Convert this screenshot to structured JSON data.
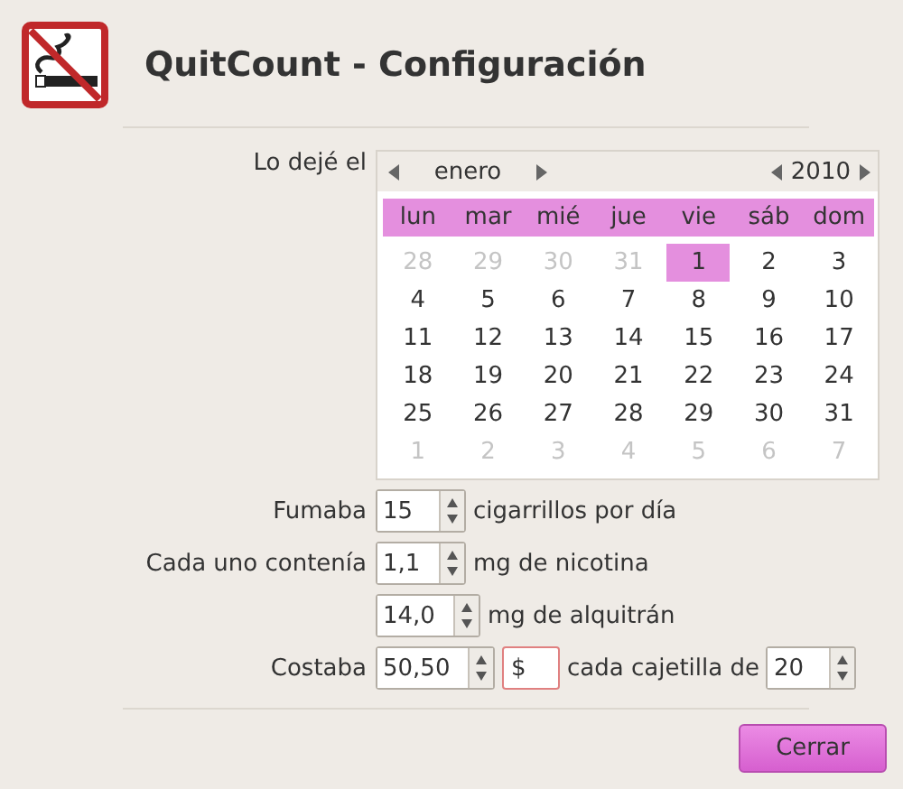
{
  "header": {
    "title": "QuitCount - Configuración"
  },
  "quit_date": {
    "label": "Lo dejé el",
    "calendar": {
      "month": "enero",
      "year": "2010",
      "weekdays": [
        "lun",
        "mar",
        "mié",
        "jue",
        "vie",
        "sáb",
        "dom"
      ],
      "days": [
        {
          "day": "28",
          "other_month": true,
          "selected": false
        },
        {
          "day": "29",
          "other_month": true,
          "selected": false
        },
        {
          "day": "30",
          "other_month": true,
          "selected": false
        },
        {
          "day": "31",
          "other_month": true,
          "selected": false
        },
        {
          "day": "1",
          "other_month": false,
          "selected": true
        },
        {
          "day": "2",
          "other_month": false,
          "selected": false
        },
        {
          "day": "3",
          "other_month": false,
          "selected": false
        },
        {
          "day": "4",
          "other_month": false,
          "selected": false
        },
        {
          "day": "5",
          "other_month": false,
          "selected": false
        },
        {
          "day": "6",
          "other_month": false,
          "selected": false
        },
        {
          "day": "7",
          "other_month": false,
          "selected": false
        },
        {
          "day": "8",
          "other_month": false,
          "selected": false
        },
        {
          "day": "9",
          "other_month": false,
          "selected": false
        },
        {
          "day": "10",
          "other_month": false,
          "selected": false
        },
        {
          "day": "11",
          "other_month": false,
          "selected": false
        },
        {
          "day": "12",
          "other_month": false,
          "selected": false
        },
        {
          "day": "13",
          "other_month": false,
          "selected": false
        },
        {
          "day": "14",
          "other_month": false,
          "selected": false
        },
        {
          "day": "15",
          "other_month": false,
          "selected": false
        },
        {
          "day": "16",
          "other_month": false,
          "selected": false
        },
        {
          "day": "17",
          "other_month": false,
          "selected": false
        },
        {
          "day": "18",
          "other_month": false,
          "selected": false
        },
        {
          "day": "19",
          "other_month": false,
          "selected": false
        },
        {
          "day": "20",
          "other_month": false,
          "selected": false
        },
        {
          "day": "21",
          "other_month": false,
          "selected": false
        },
        {
          "day": "22",
          "other_month": false,
          "selected": false
        },
        {
          "day": "23",
          "other_month": false,
          "selected": false
        },
        {
          "day": "24",
          "other_month": false,
          "selected": false
        },
        {
          "day": "25",
          "other_month": false,
          "selected": false
        },
        {
          "day": "26",
          "other_month": false,
          "selected": false
        },
        {
          "day": "27",
          "other_month": false,
          "selected": false
        },
        {
          "day": "28",
          "other_month": false,
          "selected": false
        },
        {
          "day": "29",
          "other_month": false,
          "selected": false
        },
        {
          "day": "30",
          "other_month": false,
          "selected": false
        },
        {
          "day": "31",
          "other_month": false,
          "selected": false
        },
        {
          "day": "1",
          "other_month": true,
          "selected": false
        },
        {
          "day": "2",
          "other_month": true,
          "selected": false
        },
        {
          "day": "3",
          "other_month": true,
          "selected": false
        },
        {
          "day": "4",
          "other_month": true,
          "selected": false
        },
        {
          "day": "5",
          "other_month": true,
          "selected": false
        },
        {
          "day": "6",
          "other_month": true,
          "selected": false
        },
        {
          "day": "7",
          "other_month": true,
          "selected": false
        }
      ]
    }
  },
  "rows": [
    {
      "label": "Fumaba",
      "items": [
        {
          "kind": "spin",
          "value": "15"
        },
        {
          "kind": "text",
          "text": "cigarrillos por día"
        }
      ]
    },
    {
      "label": "Cada uno contenía",
      "items": [
        {
          "kind": "spin",
          "value": "1,1"
        },
        {
          "kind": "text",
          "text": "mg de nicotina"
        }
      ]
    },
    {
      "items": [
        {
          "kind": "spin",
          "value": "14,0"
        },
        {
          "kind": "text",
          "text": "mg de alquitrán"
        }
      ]
    },
    {
      "label": "Costaba",
      "items": [
        {
          "kind": "spin",
          "value": "50,50"
        },
        {
          "kind": "entry",
          "value": "$"
        },
        {
          "kind": "text",
          "text": "cada cajetilla de"
        },
        {
          "kind": "spin",
          "value": "20"
        }
      ]
    }
  ],
  "buttons": [
    "Cerrar"
  ]
}
